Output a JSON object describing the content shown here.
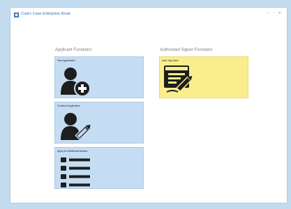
{
  "window": {
    "title": "Coal's Case Enterprise Kiosk",
    "controls": "– ▫ ✕"
  },
  "applicant": {
    "heading": "Applicant Functions",
    "tiles": [
      {
        "label": "New Application",
        "icon": "person-add-icon"
      },
      {
        "label": "Continue Application",
        "icon": "person-edit-icon"
      },
      {
        "label": "Apply for Additional Access",
        "icon": "list-icon"
      }
    ]
  },
  "signer": {
    "heading": "Authorized Signer Functions",
    "tiles": [
      {
        "label": "Auth Sig Listen",
        "icon": "sign-document-icon"
      }
    ]
  },
  "colors": {
    "background": "#c3dbee",
    "tile_blue": "#c5ddf3",
    "tile_yellow": "#faee8c",
    "icon_dark": "#1e1e1e",
    "title_blue": "#2e6eb5"
  }
}
